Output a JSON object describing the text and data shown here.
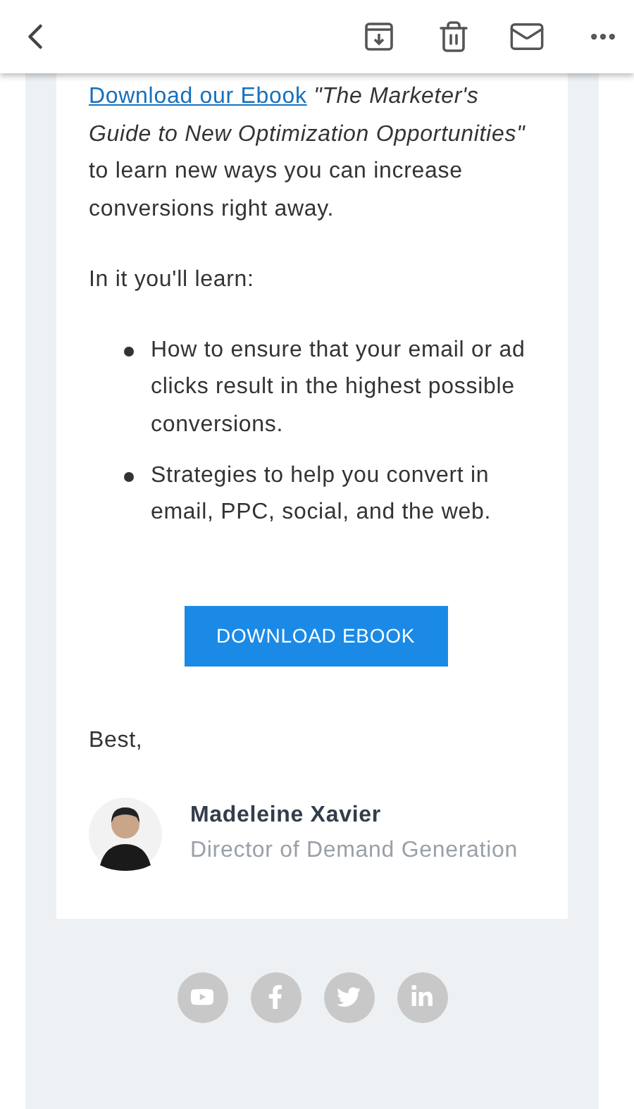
{
  "email": {
    "intro": {
      "link": "Download our Ebook",
      "title": "\"The Marketer's Guide to New Optimization Opportunities\"",
      "text": "to learn new ways you can increase conversions right away."
    },
    "lead": "In it you'll learn:",
    "bullets": [
      "How to ensure that your email or ad clicks result in the highest possible conversions.",
      "Strategies to help you convert in email, PPC, social, and the web."
    ],
    "button": "DOWNLOAD EBOOK",
    "closing": "Best,",
    "signature": {
      "name": "Madeleine Xavier",
      "title": "Director of Demand Generation"
    }
  }
}
